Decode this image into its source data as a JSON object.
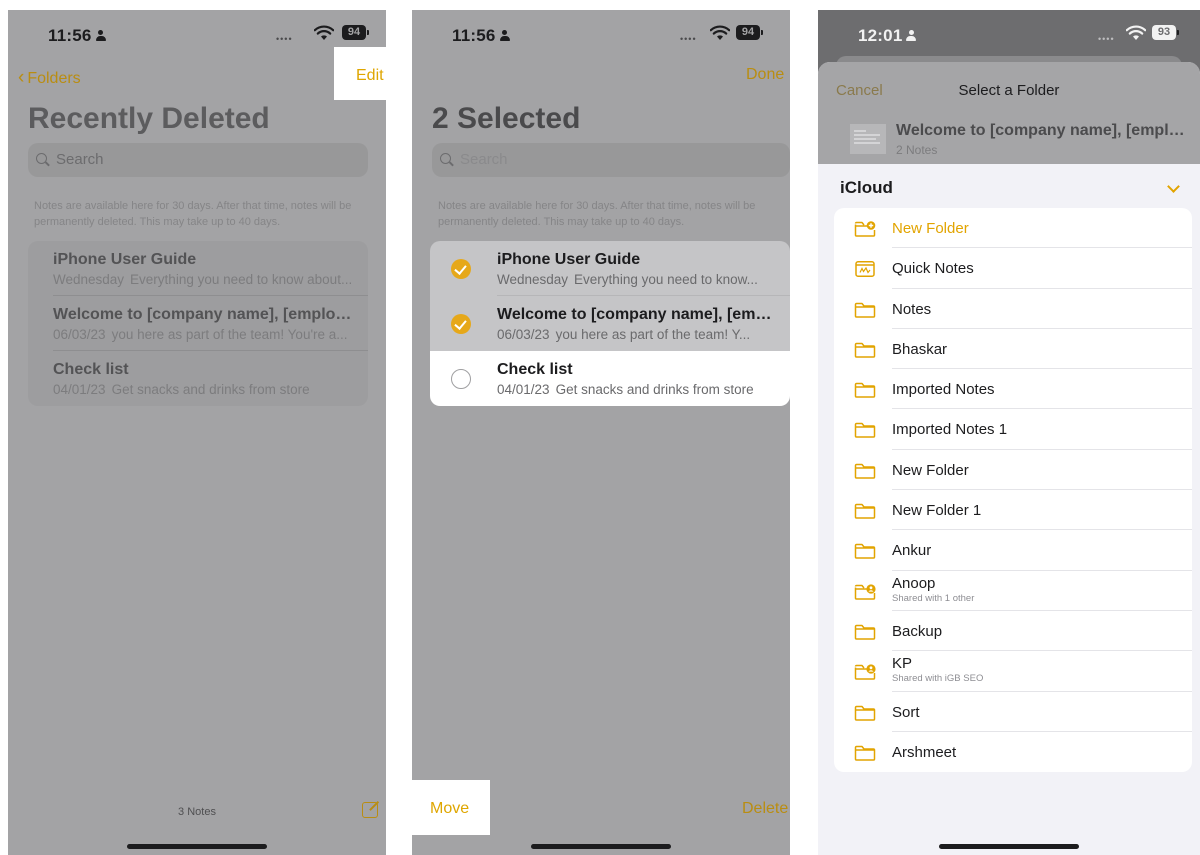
{
  "colors": {
    "accent": "#e2a400",
    "dim_accent": "#b98d12"
  },
  "screen1": {
    "status": {
      "time": "11:56",
      "battery": "94"
    },
    "nav": {
      "back_label": "Folders",
      "edit_label": "Edit"
    },
    "title": "Recently Deleted",
    "search_placeholder": "Search",
    "info": "Notes are available here for 30 days. After that time, notes will be permanently deleted. This may take up to 40 days.",
    "notes": [
      {
        "title": "iPhone User Guide",
        "date": "Wednesday",
        "preview": "Everything you need to know about..."
      },
      {
        "title": "Welcome to [company name], [employee...",
        "date": "06/03/23",
        "preview": "you here as part of the team! You're a..."
      },
      {
        "title": "Check list",
        "date": "04/01/23",
        "preview": "Get snacks and drinks from store"
      }
    ],
    "footer_count": "3 Notes"
  },
  "screen2": {
    "status": {
      "time": "11:56",
      "battery": "94"
    },
    "nav": {
      "done_label": "Done"
    },
    "title": "2 Selected",
    "search_placeholder": "Search",
    "info": "Notes are available here for 30 days. After that time, notes will be permanently deleted. This may take up to 40 days.",
    "notes": [
      {
        "title": "iPhone User Guide",
        "date": "Wednesday",
        "preview": "Everything you need to know...",
        "selected": true
      },
      {
        "title": "Welcome to [company name], [empl...",
        "date": "06/03/23",
        "preview": "you here as part of the team! Y...",
        "selected": true
      },
      {
        "title": "Check list",
        "date": "04/01/23",
        "preview": "Get snacks and drinks from store",
        "selected": false
      }
    ],
    "toolbar": {
      "move_label": "Move",
      "delete_label": "Delete"
    }
  },
  "screen3": {
    "status": {
      "time": "12:01",
      "battery": "93"
    },
    "sheet": {
      "cancel_label": "Cancel",
      "title": "Select a Folder",
      "note_title": "Welcome to [company name], [emplo...",
      "note_sub": "2 Notes"
    },
    "account": "iCloud",
    "folders": [
      {
        "name": "New Folder",
        "icon": "new-folder-icon",
        "accent": true
      },
      {
        "name": "Quick Notes",
        "icon": "quick-notes-icon"
      },
      {
        "name": "Notes",
        "icon": "folder-icon"
      },
      {
        "name": "Bhaskar",
        "icon": "folder-icon"
      },
      {
        "name": "Imported Notes",
        "icon": "folder-icon"
      },
      {
        "name": "Imported Notes 1",
        "icon": "folder-icon"
      },
      {
        "name": "New Folder",
        "icon": "folder-icon"
      },
      {
        "name": "New Folder 1",
        "icon": "folder-icon"
      },
      {
        "name": "Ankur",
        "icon": "folder-icon"
      },
      {
        "name": "Anoop",
        "icon": "shared-folder-icon",
        "sub": "Shared with 1 other"
      },
      {
        "name": "Backup",
        "icon": "folder-icon"
      },
      {
        "name": "KP",
        "icon": "shared-folder-icon",
        "sub": "Shared with iGB SEO"
      },
      {
        "name": "Sort",
        "icon": "folder-icon"
      },
      {
        "name": "Arshmeet",
        "icon": "folder-icon"
      }
    ]
  }
}
